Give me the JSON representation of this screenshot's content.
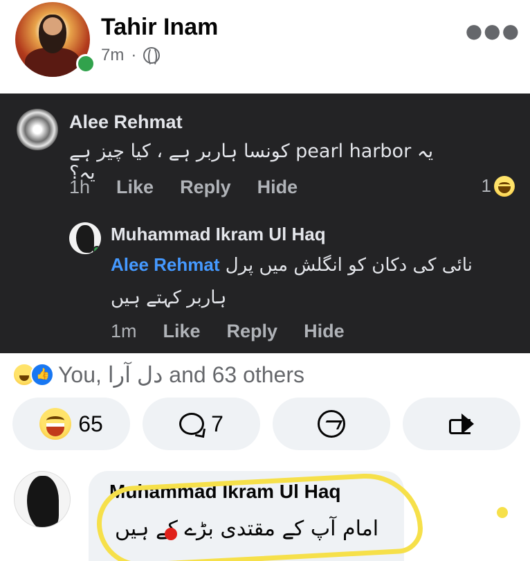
{
  "post": {
    "author": "Tahir Inam",
    "time": "7m",
    "separator": "·"
  },
  "screenshot": {
    "comment1": {
      "author": "Alee Rehmat",
      "text": "یہ pearl harbor کونسا ہاربر ہے ، کیا چیز ہے یہ؟",
      "time": "1h",
      "like": "Like",
      "reply": "Reply",
      "hide": "Hide",
      "reaction_count": "1"
    },
    "reply1": {
      "author": "Muhammad Ikram Ul Haq",
      "mention": "Alee Rehmat",
      "text_line1": "نائی کی دکان کو انگلش میں پرل",
      "text_line2": "ہاربر کہتے ہیں",
      "time": "1m",
      "like": "Like",
      "reply": "Reply",
      "hide": "Hide"
    }
  },
  "reactions_summary": "You, دل آرا and 63 others",
  "actions": {
    "reaction_count": "65",
    "comment_count": "7"
  },
  "bottom_comment": {
    "author": "Muhammad Ikram Ul Haq",
    "text": "امام آپ کے مقتدی بڑے کے ہیں"
  },
  "colors": {
    "dark_bg": "#232325",
    "highlight": "#f6e04a",
    "online": "#31a24c",
    "mention": "#4599ff"
  }
}
